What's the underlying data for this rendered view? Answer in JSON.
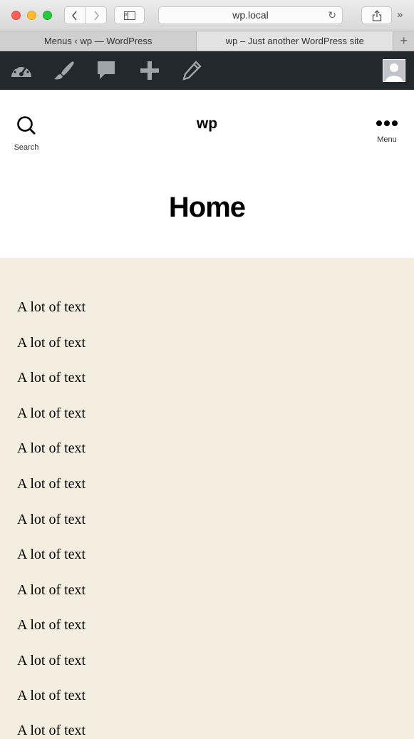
{
  "browser": {
    "url": "wp.local",
    "tabs": [
      {
        "label": "Menus ‹ wp — WordPress",
        "active": false
      },
      {
        "label": "wp – Just another WordPress site",
        "active": true
      }
    ],
    "new_tab": "+"
  },
  "admin_bar": {
    "icons": [
      "dashboard-icon",
      "customize-brush-icon",
      "comments-icon",
      "new-content-plus-icon",
      "edit-pencil-icon"
    ]
  },
  "site": {
    "title": "wp",
    "search_label": "Search",
    "menu_label": "Menu"
  },
  "page": {
    "title": "Home",
    "paragraphs": [
      "A lot of text",
      "A lot of text",
      "A lot of text",
      "A lot of text",
      "A lot of text",
      "A lot of text",
      "A lot of text",
      "A lot of text",
      "A lot of text",
      "A lot of text",
      "A lot of text",
      "A lot of text",
      "A lot of text"
    ]
  },
  "colors": {
    "admin_bar": "#23282d",
    "content_bg": "#f4ede0"
  }
}
